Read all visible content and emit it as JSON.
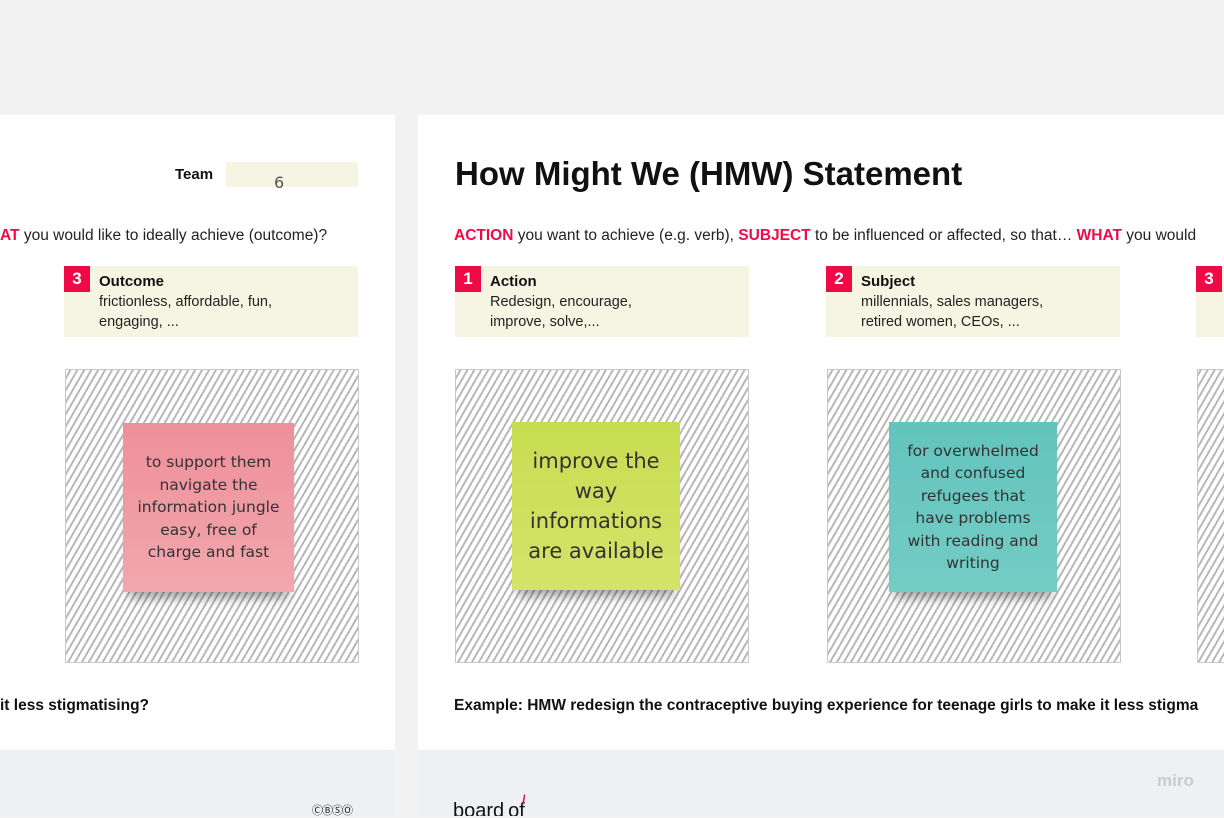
{
  "left_panel": {
    "team_label": "Team",
    "team_value": "6",
    "question": {
      "kw_end": "AT",
      "text": " you would like to ideally achieve (outcome)?"
    },
    "outcome": {
      "number": "3",
      "title": "Outcome",
      "desc_line1": "frictionless, affordable, fun,",
      "desc_line2": "engaging, ..."
    },
    "sticky": {
      "text": "to support them navigate the information jungle easy, free of charge and fast",
      "color": "#f1a0a8"
    },
    "example_tail": "it less stigmatising?"
  },
  "right_panel": {
    "title": "How Might We (HMW) Statement",
    "question": {
      "kw1": "ACTION",
      "t1": " you want to achieve (e.g. verb), ",
      "kw2": "SUBJECT",
      "t2": " to be influenced or affected, so that… ",
      "kw3": "WHAT",
      "t3": " you would"
    },
    "action": {
      "number": "1",
      "title": "Action",
      "desc_line1": "Redesign, encourage,",
      "desc_line2": "improve, solve,..."
    },
    "subject": {
      "number": "2",
      "title": "Subject",
      "desc_line1": "millennials, sales managers,",
      "desc_line2": "retired women, CEOs, ..."
    },
    "partial_number": "3",
    "sticky_action": {
      "text": "improve the way informations are available",
      "color": "#cfe060"
    },
    "sticky_subject": {
      "text": "for overwhelmed and confused refugees that have problems with reading and writing",
      "color": "#6ec9c2"
    },
    "example": "Example: HMW redesign the contraceptive buying experience for teenage girls to make it less stigma"
  },
  "footer": {
    "license_icons": "ⒸⒷⓈⓄ",
    "logo_text": "board",
    "logo_suffix": "of",
    "watermark": "miro"
  },
  "colors": {
    "accent": "#ef0a47",
    "label_bg": "#f6f5e3",
    "canvas_bg": "#f2f2f2"
  }
}
